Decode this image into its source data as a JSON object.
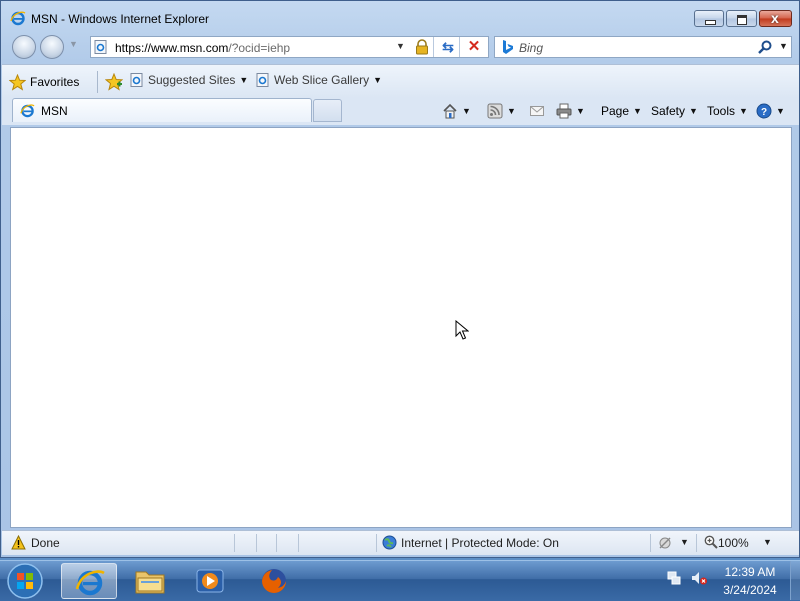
{
  "window": {
    "title": "MSN - Windows Internet Explorer",
    "caption_buttons": [
      "minimize",
      "maximize",
      "close"
    ],
    "close_glyph": "x"
  },
  "address_bar": {
    "url_host": "https://www.msn.com",
    "url_rest": "/?ocid=iehp",
    "icons": [
      "page-icon",
      "dropdown-arrow",
      "lock-icon",
      "refresh-icon",
      "stop-icon"
    ],
    "refresh_glyph": "⇆",
    "stop_glyph": "✕"
  },
  "search": {
    "placeholder": "Bing",
    "icons": [
      "bing-icon",
      "search-icon",
      "dropdown-arrow"
    ]
  },
  "favorites_bar": {
    "favorites_label": "Favorites",
    "links": [
      {
        "label": "Suggested Sites"
      },
      {
        "label": "Web Slice Gallery"
      }
    ],
    "caret": "▼"
  },
  "tabs": [
    {
      "label": "MSN",
      "active": true
    }
  ],
  "command_bar": {
    "page_label": "Page",
    "safety_label": "Safety",
    "tools_label": "Tools",
    "caret": "▼"
  },
  "status_bar": {
    "status": "Done",
    "zone": "Internet | Protected Mode: On",
    "zoom": "100%",
    "caret": "▼"
  },
  "taskbar": {
    "pinned": [
      "internet-explorer",
      "windows-explorer",
      "windows-media-player",
      "firefox"
    ],
    "active": "internet-explorer",
    "clock_time": "12:39 AM",
    "clock_date": "3/24/2024"
  },
  "colors": {
    "accent": "#2a6cc5",
    "close_red": "#c1391c",
    "taskbar": "#3f6da7"
  }
}
